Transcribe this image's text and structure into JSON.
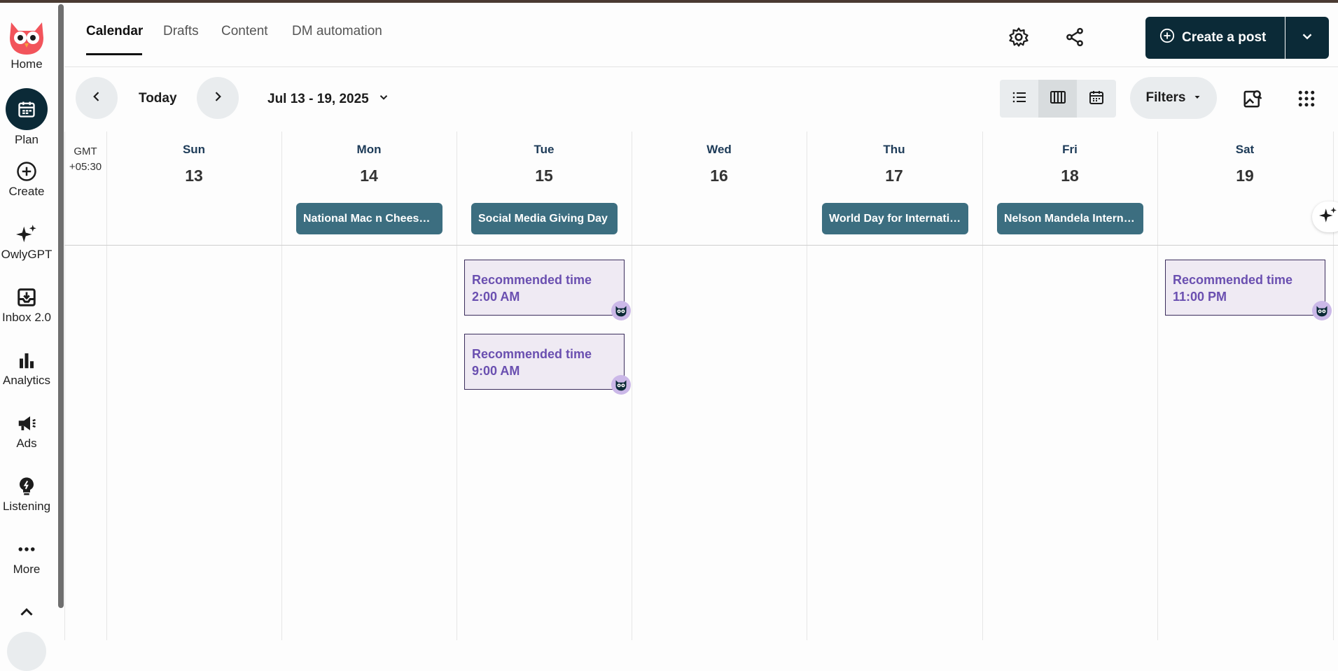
{
  "sidebar": {
    "items": [
      {
        "label": "Home",
        "icon": "owl-logo"
      },
      {
        "label": "Plan",
        "icon": "calendar-icon"
      },
      {
        "label": "Create",
        "icon": "plus-circle-icon"
      },
      {
        "label": "OwlyGPT",
        "icon": "sparkles-icon"
      },
      {
        "label": "Inbox 2.0",
        "icon": "inbox-icon"
      },
      {
        "label": "Analytics",
        "icon": "bar-chart-icon"
      },
      {
        "label": "Ads",
        "icon": "megaphone-icon"
      },
      {
        "label": "Listening",
        "icon": "lightbulb-icon"
      },
      {
        "label": "More",
        "icon": "more-dots-icon"
      }
    ]
  },
  "header": {
    "tabs": [
      "Calendar",
      "Drafts",
      "Content",
      "DM automation"
    ],
    "active_tab": "Calendar",
    "create_label": "Create a post"
  },
  "toolbar": {
    "today_label": "Today",
    "date_range": "Jul 13 - 19, 2025",
    "filters_label": "Filters"
  },
  "calendar": {
    "timezone_line1": "GMT",
    "timezone_line2": "+05:30",
    "days": [
      {
        "name": "Sun",
        "num": "13"
      },
      {
        "name": "Mon",
        "num": "14"
      },
      {
        "name": "Tue",
        "num": "15"
      },
      {
        "name": "Wed",
        "num": "16"
      },
      {
        "name": "Thu",
        "num": "17"
      },
      {
        "name": "Fri",
        "num": "18"
      },
      {
        "name": "Sat",
        "num": "19"
      }
    ],
    "holidays": {
      "mon": "National Mac n Cheese Day",
      "tue": "Social Media Giving Day",
      "thu": "World Day for International Justice",
      "fri": "Nelson Mandela International Day"
    },
    "recommendations": [
      {
        "title": "Recommended time",
        "time": "2:00 AM"
      },
      {
        "title": "Recommended time",
        "time": "9:00 AM"
      },
      {
        "title": "Recommended time",
        "time": "11:00 PM"
      }
    ]
  },
  "colors": {
    "brand_dark": "#0b2a37",
    "holiday_bg": "#3c6e80",
    "recommend_text": "#6a4fb0",
    "owl_red": "#f2545b"
  }
}
